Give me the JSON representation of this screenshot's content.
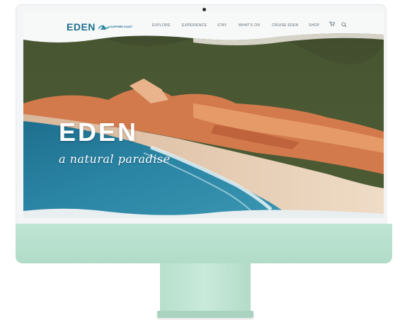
{
  "site": {
    "brand": "EDEN",
    "brand_sub": "SAPPHIRE COAST"
  },
  "nav": {
    "items": [
      {
        "label": "EXPLORE"
      },
      {
        "label": "EXPERIENCE"
      },
      {
        "label": "STAY"
      },
      {
        "label": "WHAT'S ON"
      },
      {
        "label": "CRUISE EDEN"
      },
      {
        "label": "SHOP"
      }
    ],
    "icons": [
      "cart-icon",
      "search-icon"
    ]
  },
  "hero": {
    "title": "EDEN",
    "tagline": "a natural paradise"
  },
  "colors": {
    "brand": "#1c6f8f",
    "monitor": "#b8e0cd",
    "sea": "#2f7fa0",
    "sand": "#e9d2b8",
    "cliff": "#d9744a"
  }
}
